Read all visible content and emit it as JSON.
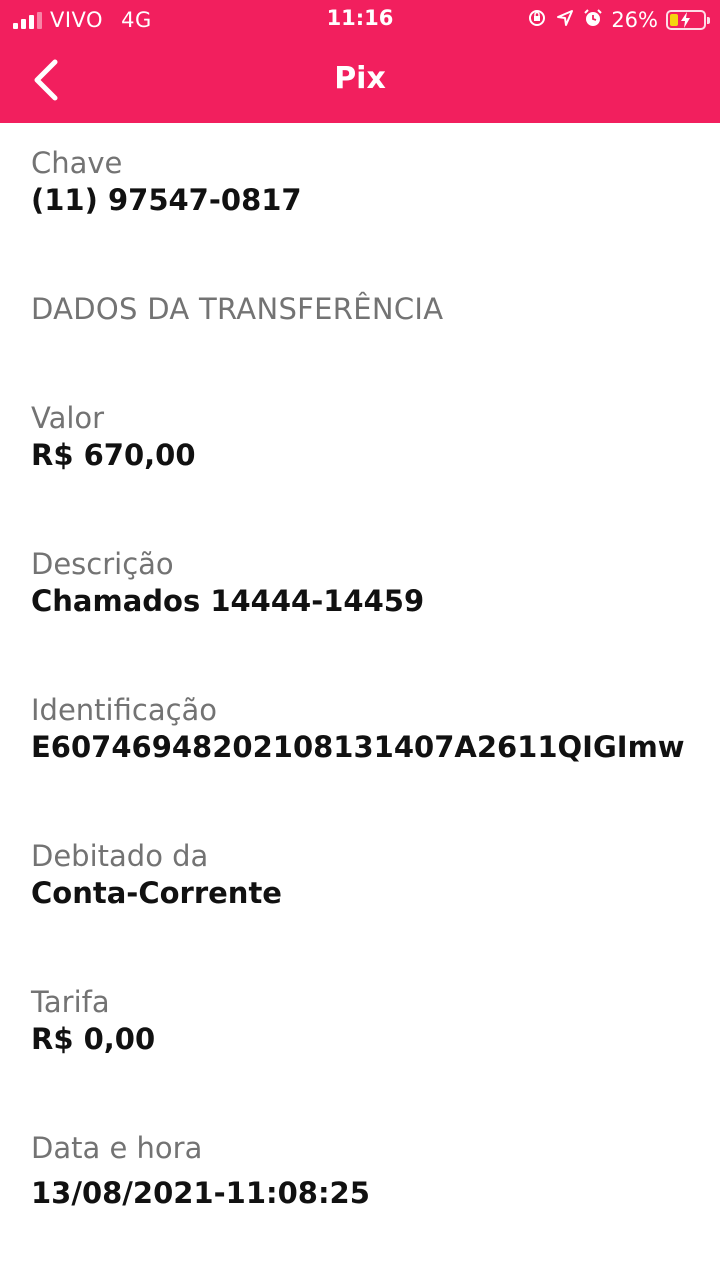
{
  "status_bar": {
    "carrier": "VIVO",
    "network": "4G",
    "time": "11:16",
    "battery_percent": "26%",
    "battery_level": 0.26,
    "battery_color": "#f5d50f",
    "icons": [
      "signal-icon",
      "screen-rotation-lock-icon",
      "location-arrow-icon",
      "alarm-icon",
      "battery-charging-icon"
    ]
  },
  "nav": {
    "title": "Pix",
    "background_color": "#f21f5e",
    "back_icon": "chevron-left-icon"
  },
  "details": {
    "chave": {
      "label": "Chave",
      "value": "(11) 97547-0817"
    },
    "section_title": "DADOS DA TRANSFERÊNCIA",
    "valor": {
      "label": "Valor",
      "value": "R$ 670,00"
    },
    "descricao": {
      "label": "Descrição",
      "value": "Chamados 14444-14459"
    },
    "identificacao": {
      "label": "Identificação",
      "value": "E60746948202108131407A2611QIGImw"
    },
    "debitado": {
      "label": "Debitado da",
      "value": "Conta-Corrente"
    },
    "tarifa": {
      "label": "Tarifa",
      "value": "R$ 0,00"
    },
    "data_hora": {
      "label": "Data e hora",
      "value": "13/08/2021-11:08:25"
    }
  }
}
